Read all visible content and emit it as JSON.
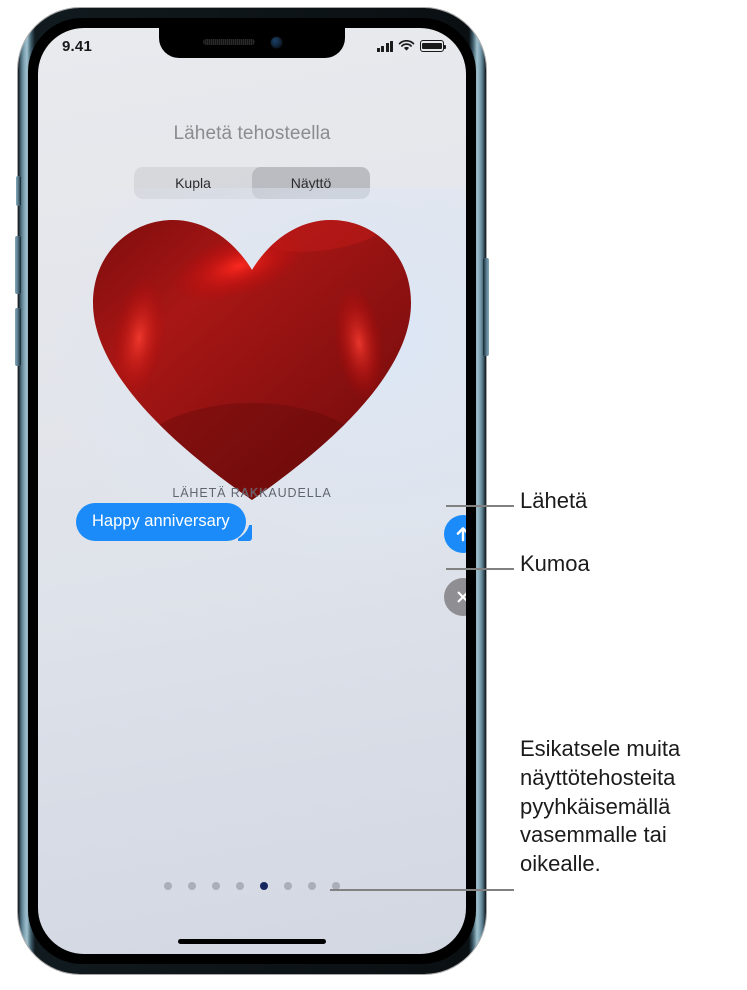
{
  "status_bar": {
    "time": "9.41",
    "cellular_icon": "cellular-signal-icon",
    "wifi_icon": "wifi-icon",
    "battery_icon": "battery-icon"
  },
  "screen": {
    "title": "Lähetä tehosteella",
    "segmented_control": {
      "options": [
        {
          "label": "Kupla",
          "selected": false
        },
        {
          "label": "Näyttö",
          "selected": true
        }
      ]
    },
    "effect_preview": {
      "graphic": "red-balloon-heart",
      "effect_name": "LÄHETÄ RAKKAUDELLA"
    },
    "message": {
      "bubble_text": "Happy anniversary",
      "bubble_color": "#1b8bf9",
      "text_color": "#ffffff"
    },
    "actions": {
      "send": {
        "icon": "arrow-up-icon",
        "color": "#1b8bf9"
      },
      "cancel": {
        "icon": "close-x-icon",
        "color": "#8e8e93"
      }
    },
    "page_indicator": {
      "total": 8,
      "active_index": 4,
      "active_color": "#15265c",
      "inactive_color": "#a9aeb9"
    }
  },
  "callouts": [
    {
      "id": "send",
      "label": "Lähetä"
    },
    {
      "id": "cancel",
      "label": "Kumoa"
    },
    {
      "id": "swipe",
      "label": "Esikatsele muita näyttötehosteita pyyhkäisemällä vasemmalle tai oikealle."
    }
  ]
}
